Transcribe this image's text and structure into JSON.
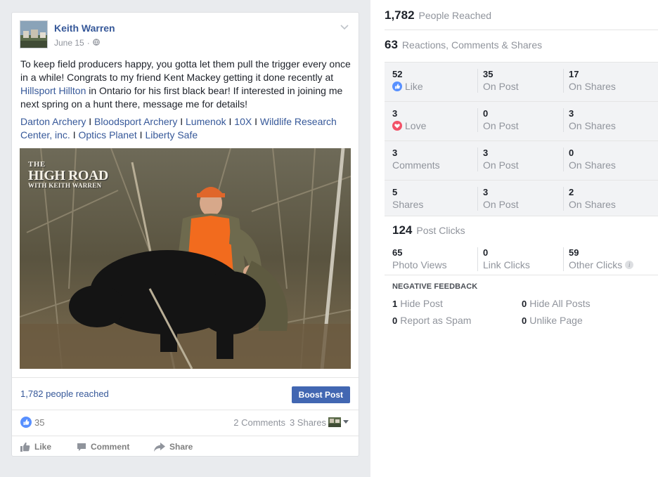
{
  "post": {
    "author": "Keith Warren",
    "date": "June 15",
    "date_sep": "·",
    "text_part1": "To keep field producers happy, you gotta let them pull the trigger every once in a while! Congrats to my friend Kent Mackey getting it done recently at ",
    "text_link": "Hillsport Hillton",
    "text_part2": " in Ontario for his first black bear! If interested in joining me next spring on a hunt there, message me for details!",
    "sponsors": [
      "Darton Archery",
      "Bloodsport Archery",
      "Lumenok",
      "10X",
      "Wildlife Research Center, inc.",
      "Optics Planet",
      "Liberty Safe"
    ],
    "sponsor_sep": " I ",
    "photo_logo": {
      "line1": "THE",
      "line2": "HIGH ROAD",
      "line3": "WITH KEITH WARREN"
    },
    "reach_text": "1,782 people reached",
    "boost_label": "Boost Post",
    "like_count": "35",
    "comments_text": "2 Comments",
    "shares_text": "3 Shares",
    "actions": {
      "like": "Like",
      "comment": "Comment",
      "share": "Share"
    },
    "colors": {
      "link": "#365899",
      "boost": "#4267b2",
      "like_blue": "#5890ff"
    }
  },
  "insights": {
    "people_reached": {
      "num": "1,782",
      "label": "People Reached"
    },
    "engagement": {
      "num": "63",
      "label": "Reactions, Comments & Shares"
    },
    "rows": [
      {
        "total": "52",
        "label": "Like",
        "icon": "like-icon",
        "on_post": "35",
        "on_post_label": "On Post",
        "on_shares": "17",
        "on_shares_label": "On Shares"
      },
      {
        "total": "3",
        "label": "Love",
        "icon": "love-icon",
        "on_post": "0",
        "on_post_label": "On Post",
        "on_shares": "3",
        "on_shares_label": "On Shares"
      },
      {
        "total": "3",
        "label": "Comments",
        "icon": "",
        "on_post": "3",
        "on_post_label": "On Post",
        "on_shares": "0",
        "on_shares_label": "On Shares"
      },
      {
        "total": "5",
        "label": "Shares",
        "icon": "",
        "on_post": "3",
        "on_post_label": "On Post",
        "on_shares": "2",
        "on_shares_label": "On Shares"
      }
    ],
    "post_clicks": {
      "num": "124",
      "label": "Post Clicks"
    },
    "clicks": [
      {
        "num": "65",
        "label": "Photo Views"
      },
      {
        "num": "0",
        "label": "Link Clicks"
      },
      {
        "num": "59",
        "label": "Other Clicks"
      }
    ],
    "negative_title": "NEGATIVE FEEDBACK",
    "negative": [
      {
        "num": "1",
        "label": "Hide Post"
      },
      {
        "num": "0",
        "label": "Hide All Posts"
      },
      {
        "num": "0",
        "label": "Report as Spam"
      },
      {
        "num": "0",
        "label": "Unlike Page"
      }
    ]
  }
}
